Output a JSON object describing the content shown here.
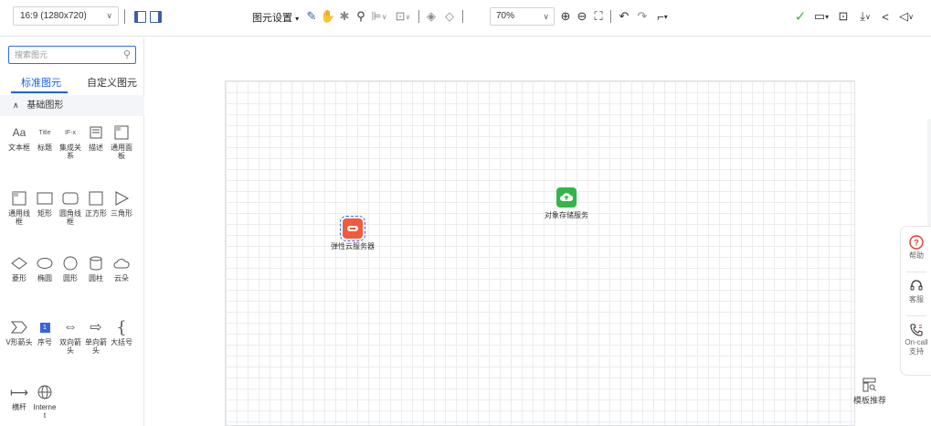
{
  "toolbar": {
    "ratio_value": "16:9 (1280x720)",
    "element_settings": "图元设置",
    "zoom_value": "70%"
  },
  "sidebar": {
    "search_placeholder": "搜索图元",
    "tabs": [
      {
        "label": "标准图元",
        "active": true
      },
      {
        "label": "自定义图元",
        "active": false
      }
    ],
    "section_title": "基础图形",
    "shapes": [
      {
        "label": "文本框",
        "icon": "text-box-icon",
        "glyph": "Aa"
      },
      {
        "label": "标题",
        "icon": "title-icon",
        "glyph": "Title"
      },
      {
        "label": "集成关系",
        "icon": "integration-icon",
        "glyph": "IF-x"
      },
      {
        "label": "描述",
        "icon": "description-icon",
        "glyph": ""
      },
      {
        "label": "通用面板",
        "icon": "panel-icon",
        "glyph": ""
      },
      {
        "label": "通用线框",
        "icon": "wireframe-icon",
        "glyph": ""
      },
      {
        "label": "矩形",
        "icon": "rectangle-icon",
        "glyph": ""
      },
      {
        "label": "圆角线框",
        "icon": "rounded-rect-icon",
        "glyph": ""
      },
      {
        "label": "正方形",
        "icon": "square-icon",
        "glyph": ""
      },
      {
        "label": "三角形",
        "icon": "triangle-icon",
        "glyph": ""
      },
      {
        "label": "菱形",
        "icon": "diamond-icon",
        "glyph": ""
      },
      {
        "label": "椭圆",
        "icon": "ellipse-icon",
        "glyph": ""
      },
      {
        "label": "圆形",
        "icon": "circle-icon",
        "glyph": ""
      },
      {
        "label": "圆柱",
        "icon": "cylinder-icon",
        "glyph": ""
      },
      {
        "label": "云朵",
        "icon": "cloud-icon",
        "glyph": ""
      },
      {
        "label": "V形箭头",
        "icon": "chevron-arrow-icon",
        "glyph": ""
      },
      {
        "label": "序号",
        "icon": "sequence-number-icon",
        "glyph": "1"
      },
      {
        "label": "双向箭头",
        "icon": "double-arrow-icon",
        "glyph": "⇔"
      },
      {
        "label": "单向箭头",
        "icon": "single-arrow-icon",
        "glyph": "⇨"
      },
      {
        "label": "大括号",
        "icon": "brace-icon",
        "glyph": "{"
      },
      {
        "label": "横杆",
        "icon": "horizontal-bar-icon",
        "glyph": "⟼"
      },
      {
        "label": "Internet",
        "icon": "globe-icon",
        "glyph": ""
      }
    ]
  },
  "canvas": {
    "nodes": [
      {
        "label": "弹性云服务器",
        "icon": "ecs-server-icon",
        "color": "#f25a3c",
        "selected": true
      },
      {
        "label": "对象存储服务",
        "icon": "obs-storage-icon",
        "color": "#33b54a",
        "selected": false
      }
    ]
  },
  "help": {
    "items": [
      {
        "label": "帮助",
        "icon": "help-icon"
      },
      {
        "label": "客服",
        "icon": "customer-service-icon"
      },
      {
        "label": "On-call支持",
        "icon": "phone-support-icon"
      }
    ]
  },
  "template_recommend": "模板推荐",
  "colors": {
    "accent": "#1d62e8",
    "save_green": "#3cb341",
    "ecs_red": "#f25a3c",
    "obs_green": "#33b54a"
  }
}
